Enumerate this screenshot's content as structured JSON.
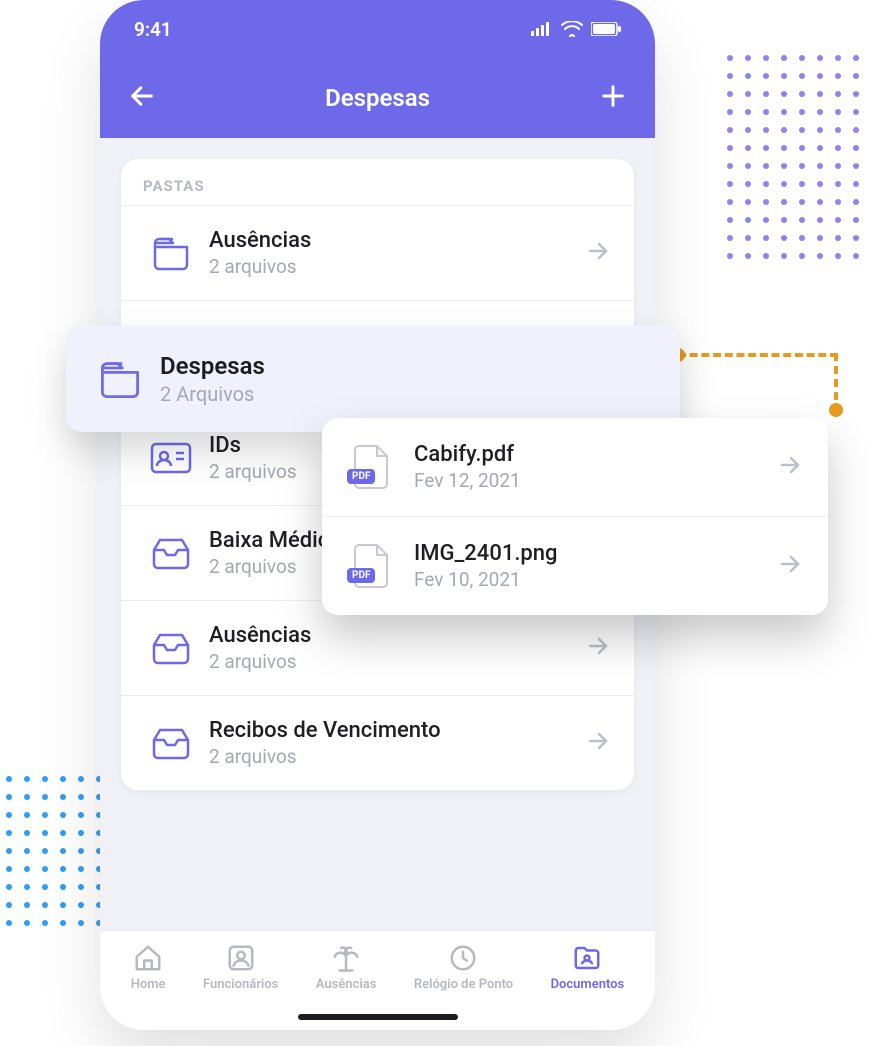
{
  "status": {
    "time": "9:41"
  },
  "appbar": {
    "title": "Despesas"
  },
  "section_label": "PASTAS",
  "folders": [
    {
      "name": "Ausências",
      "subtitle": "2 arquivos",
      "icon": "folder"
    },
    {
      "name": "Despesas",
      "subtitle": "2 Arquivos",
      "icon": "folder",
      "selected": true
    },
    {
      "name": "IDs",
      "subtitle": "2 arquivos",
      "icon": "id"
    },
    {
      "name": "Baixa Médica",
      "subtitle": "2 arquivos",
      "icon": "inbox"
    },
    {
      "name": "Ausências",
      "subtitle": "2 arquivos",
      "icon": "inbox"
    },
    {
      "name": "Recibos de Vencimento",
      "subtitle": "2 arquivos",
      "icon": "inbox"
    }
  ],
  "files": [
    {
      "name": "Cabify.pdf",
      "date": "Fev 12, 2021",
      "badge": "PDF"
    },
    {
      "name": "IMG_2401.png",
      "date": "Fev 10, 2021",
      "badge": "PDF"
    }
  ],
  "tabs": [
    {
      "label": "Home"
    },
    {
      "label": "Funcionários"
    },
    {
      "label": "Ausências"
    },
    {
      "label": "Relógio de Ponto"
    },
    {
      "label": "Documentos",
      "active": true
    }
  ]
}
